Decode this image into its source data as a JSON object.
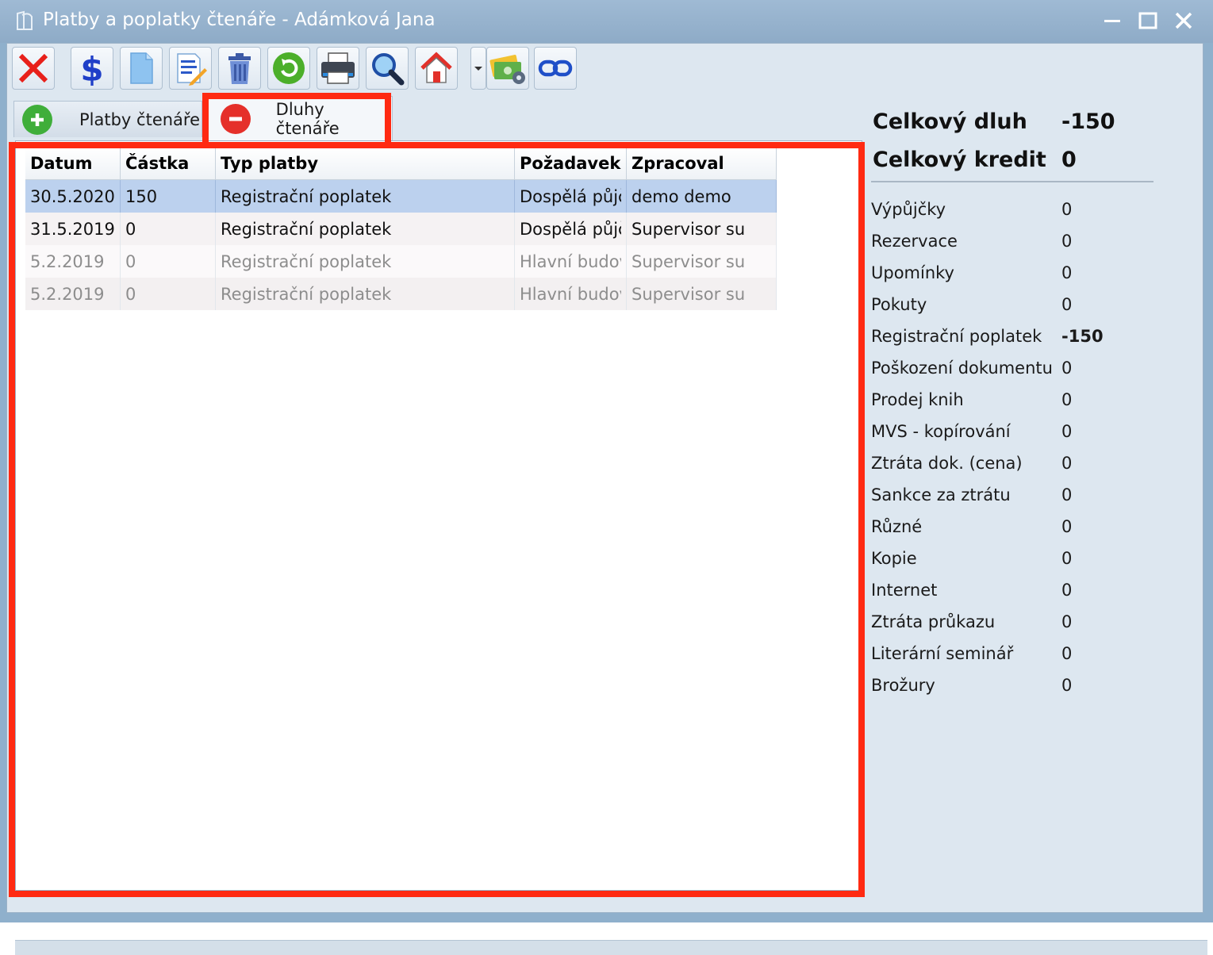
{
  "window": {
    "title": "Platby a poplatky čtenáře - Adámková Jana"
  },
  "toolbar": {
    "buttons": [
      {
        "name": "close",
        "icon": "red-x-icon"
      },
      {
        "name": "payment",
        "icon": "dollar-icon"
      },
      {
        "name": "new",
        "icon": "blank-document-icon"
      },
      {
        "name": "edit",
        "icon": "edit-document-icon"
      },
      {
        "name": "delete",
        "icon": "trash-icon"
      },
      {
        "name": "refresh",
        "icon": "refresh-icon"
      },
      {
        "name": "print",
        "icon": "printer-icon"
      },
      {
        "name": "search",
        "icon": "magnifier-icon"
      },
      {
        "name": "home",
        "icon": "house-icon"
      },
      {
        "name": "payment-settings",
        "icon": "money-gear-icon"
      },
      {
        "name": "link",
        "icon": "chain-link-icon"
      }
    ]
  },
  "tabs": [
    {
      "label": "Platby čtenáře",
      "icon": "plus-circle-icon",
      "active": false
    },
    {
      "label": "Dluhy čtenáře",
      "icon": "minus-circle-icon",
      "active": true
    }
  ],
  "grid": {
    "columns": [
      "Datum",
      "Částka",
      "Typ platby",
      "Požadavek",
      "Zpracoval"
    ],
    "rows": [
      {
        "datum": "30.5.2020",
        "castka": "150",
        "typ": "Registrační poplatek",
        "pozadavek": "Dospělá půjčovna",
        "zpracoval": "demo demo"
      },
      {
        "datum": "31.5.2019",
        "castka": "0",
        "typ": "Registrační poplatek",
        "pozadavek": "Dospělá půjčovna",
        "zpracoval": "Supervisor su"
      },
      {
        "datum": "5.2.2019",
        "castka": "0",
        "typ": "Registrační poplatek",
        "pozadavek": "Hlavní budova",
        "zpracoval": "Supervisor su"
      },
      {
        "datum": "5.2.2019",
        "castka": "0",
        "typ": "Registrační poplatek",
        "pozadavek": "Hlavní budova",
        "zpracoval": "Supervisor su"
      }
    ]
  },
  "summary": {
    "total_debt_label": "Celkový dluh",
    "total_debt_value": "-150",
    "total_credit_label": "Celkový kredit",
    "total_credit_value": "0",
    "items": [
      {
        "label": "Výpůjčky",
        "value": "0"
      },
      {
        "label": "Rezervace",
        "value": "0"
      },
      {
        "label": "Upomínky",
        "value": "0"
      },
      {
        "label": "Pokuty",
        "value": "0"
      },
      {
        "label": "Registrační poplatek",
        "value": "-150"
      },
      {
        "label": "Poškození dokumentu",
        "value": "0"
      },
      {
        "label": "Prodej knih",
        "value": "0"
      },
      {
        "label": "MVS - kopírování",
        "value": "0"
      },
      {
        "label": "Ztráta dok. (cena)",
        "value": "0"
      },
      {
        "label": "Sankce za ztrátu",
        "value": "0"
      },
      {
        "label": "Různé",
        "value": "0"
      },
      {
        "label": "Kopie",
        "value": "0"
      },
      {
        "label": "Internet",
        "value": "0"
      },
      {
        "label": "Ztráta průkazu",
        "value": "0"
      },
      {
        "label": "Literární seminář",
        "value": "0"
      },
      {
        "label": "Brožury",
        "value": "0"
      }
    ]
  },
  "colors": {
    "highlight": "#ff2a12",
    "selected_row": "#bcd1ee",
    "titlebar": "#8fb0cc"
  }
}
